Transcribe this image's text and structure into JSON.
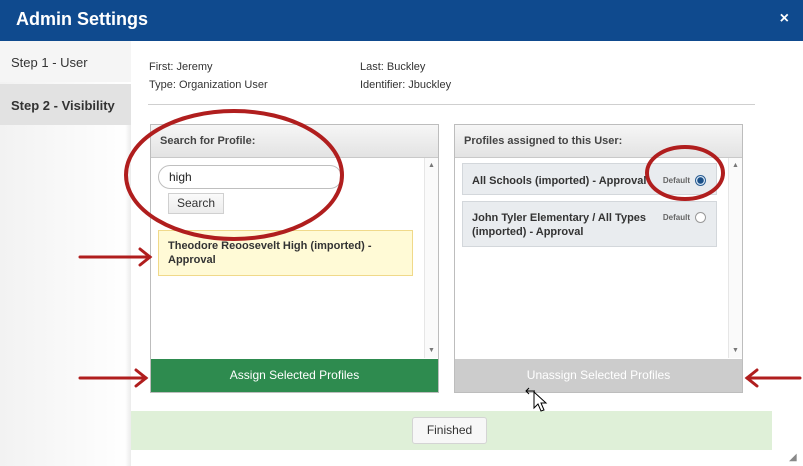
{
  "window": {
    "title": "Admin Settings",
    "close_icon": "close-icon",
    "close_glyph": "×"
  },
  "sidebar": {
    "steps": [
      {
        "label": "Step 1 - User",
        "active": false
      },
      {
        "label": "Step 2 - Visibility",
        "active": true
      }
    ]
  },
  "user": {
    "first": "First: Jeremy",
    "last": "Last: Buckley",
    "type": "Type: Organization User",
    "identifier": "Identifier: Jbuckley"
  },
  "search_panel": {
    "header": "Search for Profile:",
    "input_value": "high",
    "search_label": "Search",
    "results": [
      "Theodore Reoosevelt High (imported) - Approval"
    ],
    "assign_label": "Assign Selected Profiles"
  },
  "assigned_panel": {
    "header": "Profiles assigned to this User:",
    "default_label": "Default",
    "profiles": [
      {
        "name": "All Schools (imported) - Approval",
        "default": true
      },
      {
        "name": "John Tyler Elementary / All Types (imported) - Approval",
        "default": false
      }
    ],
    "unassign_label": "Unassign Selected Profiles"
  },
  "footer": {
    "finished_label": "Finished"
  },
  "colors": {
    "titlebar": "#0f4a8e",
    "assign": "#2e8b4f",
    "unassign": "#cccccc",
    "footer": "#dff0d8",
    "annotation": "#b01e1e",
    "result_highlight": "#fffad6"
  }
}
